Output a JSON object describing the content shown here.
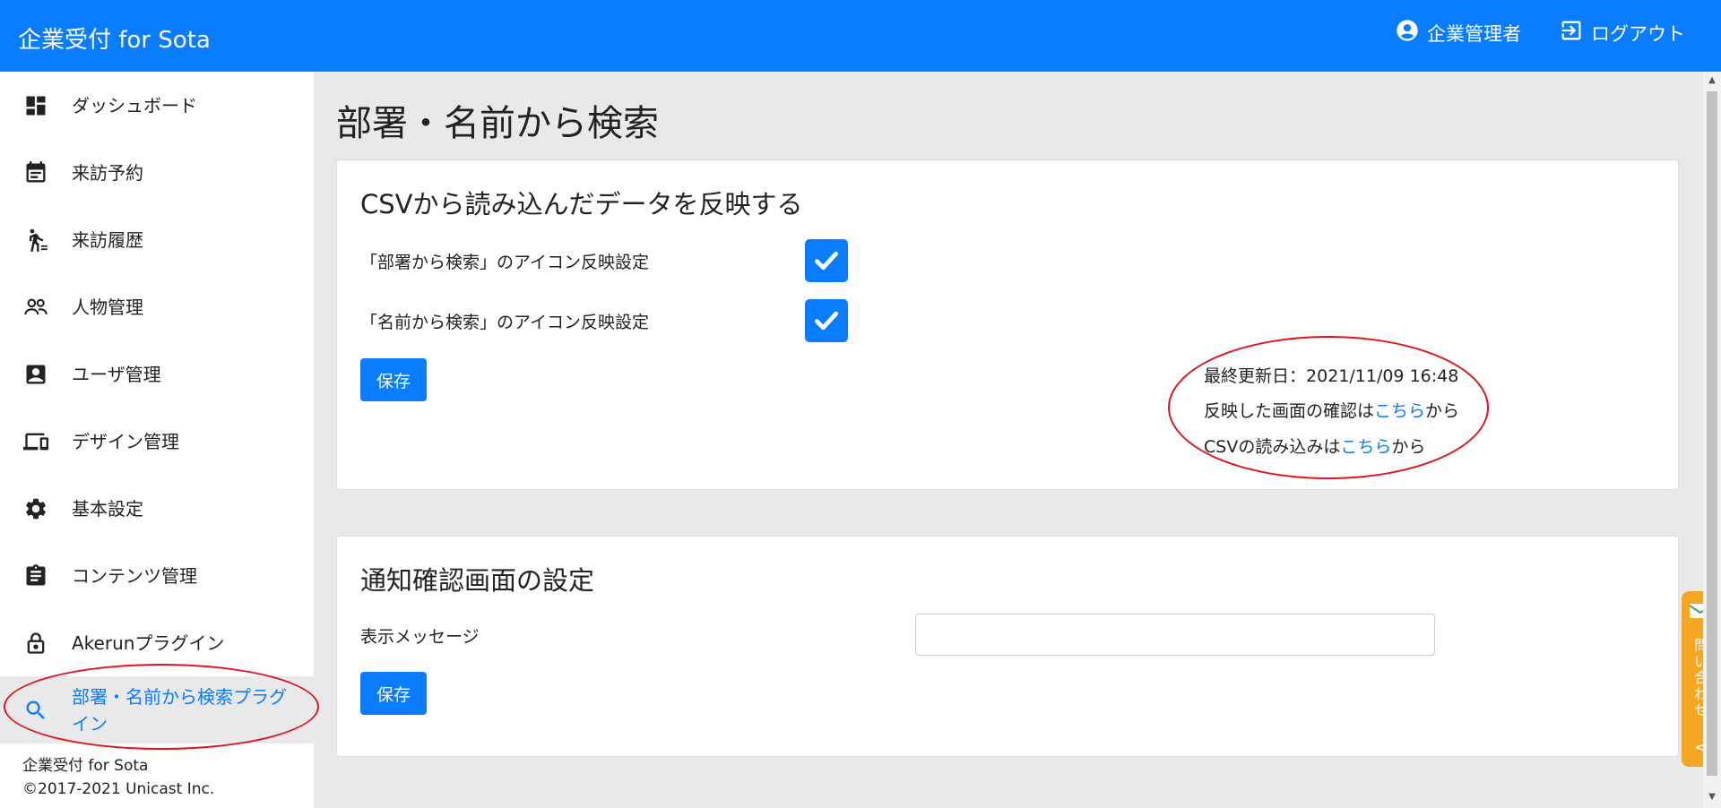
{
  "header": {
    "brand": "企業受付 for Sota",
    "user_label": "企業管理者",
    "logout_label": "ログアウト"
  },
  "sidebar": {
    "items": [
      {
        "label": "ダッシュボード",
        "icon": "dashboard-icon"
      },
      {
        "label": "来訪予約",
        "icon": "calendar-icon"
      },
      {
        "label": "来訪履歴",
        "icon": "walking-person-icon"
      },
      {
        "label": "人物管理",
        "icon": "people-icon"
      },
      {
        "label": "ユーザ管理",
        "icon": "contact-card-icon"
      },
      {
        "label": "デザイン管理",
        "icon": "devices-icon"
      },
      {
        "label": "基本設定",
        "icon": "gear-icon"
      },
      {
        "label": "コンテンツ管理",
        "icon": "clipboard-icon"
      },
      {
        "label": "Akerunプラグイン",
        "icon": "lock-icon"
      },
      {
        "label": "部署・名前から検索プラグイン",
        "icon": "search-icon"
      }
    ],
    "footer_line1": "企業受付 for Sota",
    "footer_line2": "©2017-2021 Unicast Inc."
  },
  "main": {
    "page_title": "部署・名前から検索",
    "csv_card": {
      "title": "CSVから読み込んだデータを反映する",
      "setting1_label": "「部署から検索」のアイコン反映設定",
      "setting1_checked": true,
      "setting2_label": "「名前から検索」のアイコン反映設定",
      "setting2_checked": true,
      "save_label": "保存",
      "last_updated_label": "最終更新日：",
      "last_updated_value": "2021/11/09 16:48",
      "confirm_prefix": "反映した画面の確認は",
      "confirm_link": "こちら",
      "confirm_suffix": "から",
      "csv_prefix": "CSVの読み込みは",
      "csv_link": "こちら",
      "csv_suffix": "から"
    },
    "notify_card": {
      "title": "通知確認画面の設定",
      "message_label": "表示メッセージ",
      "message_value": "",
      "save_label": "保存"
    }
  },
  "contact_tab": {
    "label": "問い合わせ",
    "arrow": "<"
  },
  "colors": {
    "primary": "#0a7cff",
    "annotation": "#e0141e",
    "contact": "#f5a623"
  }
}
